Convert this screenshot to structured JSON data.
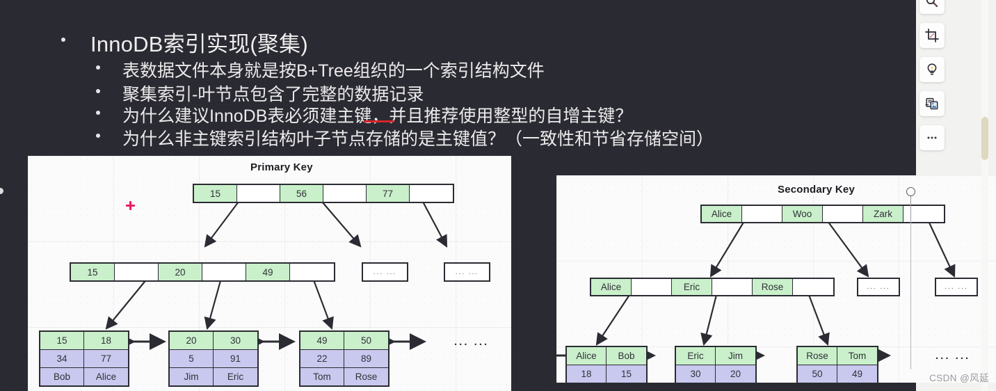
{
  "slide": {
    "heading": "InnoDB索引实现(聚集)",
    "bullets": [
      "表数据文件本身就是按B+Tree组织的一个索引结构文件",
      "聚集索引-叶节点包含了完整的数据记录",
      "为什么建议InnoDB表必须建主键，并且推荐使用整型的自增主键？",
      "为什么非主键索引结构叶子节点存储的是主键值？（一致性和节省存储空间）"
    ]
  },
  "primary_diagram": {
    "title": "Primary Key",
    "root": [
      "15",
      "",
      "56",
      "",
      "77",
      ""
    ],
    "level2": [
      "15",
      "",
      "20",
      "",
      "49",
      ""
    ],
    "level2_ellipsis": [
      "... ...",
      "... ..."
    ],
    "leaves": [
      {
        "keys": [
          "15",
          "18"
        ],
        "row2": [
          "34",
          "77"
        ],
        "row3": [
          "Bob",
          "Alice"
        ]
      },
      {
        "keys": [
          "20",
          "30"
        ],
        "row2": [
          "5",
          "91"
        ],
        "row3": [
          "Jim",
          "Eric"
        ]
      },
      {
        "keys": [
          "49",
          "50"
        ],
        "row2": [
          "22",
          "89"
        ],
        "row3": [
          "Tom",
          "Rose"
        ]
      }
    ],
    "leaf_ellipsis": "... ..."
  },
  "secondary_diagram": {
    "title": "Secondary Key",
    "root": [
      "Alice",
      "",
      "Woo",
      "",
      "Zark",
      ""
    ],
    "level2": [
      "Alice",
      "",
      "Eric",
      "",
      "Rose",
      ""
    ],
    "level2_ellipsis": [
      "... ...",
      "... ..."
    ],
    "leaves": [
      {
        "keys": [
          "Alice",
          "Bob"
        ],
        "row2": [
          "18",
          "15"
        ]
      },
      {
        "keys": [
          "Eric",
          "Jim"
        ],
        "row2": [
          "30",
          "20"
        ]
      },
      {
        "keys": [
          "Rose",
          "Tom"
        ],
        "row2": [
          "50",
          "49"
        ]
      }
    ],
    "leaf_ellipsis": "... ..."
  },
  "toolbar": {
    "items": [
      {
        "icon": "search-icon",
        "label": "Search"
      },
      {
        "icon": "crop-icon",
        "label": "Crop"
      },
      {
        "icon": "lightbulb-icon",
        "label": "Smart"
      },
      {
        "icon": "copy-image-icon",
        "label": "Copy image"
      },
      {
        "icon": "more-icon",
        "label": "More"
      }
    ]
  },
  "watermark": "CSDN @风延",
  "colors": {
    "slide_bg": "#2a2a33",
    "key_cell": "#c9f0ca",
    "value_cell": "#c9c8ee",
    "accent_red": "#d4262c",
    "cursor_pink": "#ec1d62",
    "scrollbar": "#ddd8c0"
  }
}
